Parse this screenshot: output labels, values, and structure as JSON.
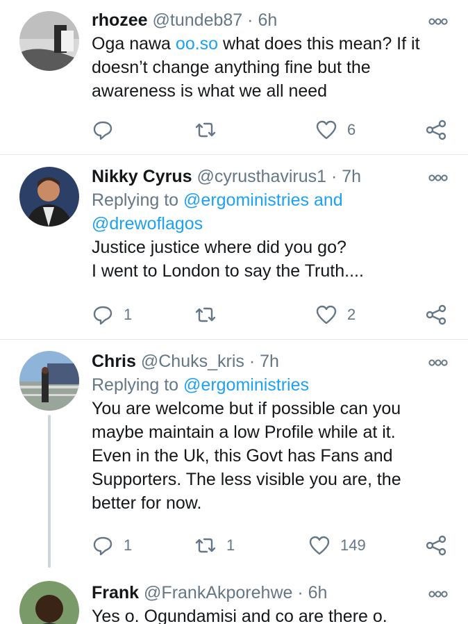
{
  "tweets": [
    {
      "name": "rhozee",
      "handle": "@tundeb87",
      "sep": "·",
      "time": "6h",
      "body_pre": "Oga nawa ",
      "body_link": "oo.so",
      "body_line1_rest": " what does this mean? If it",
      "body_line2": "doesn’t change anything fine but the",
      "body_line3": "awareness is what we all need",
      "replies": "",
      "retweets": "",
      "likes": "6"
    },
    {
      "name": "Nikky Cyrus",
      "handle": "@cyrusthavirus1",
      "sep": "·",
      "time": "7h",
      "replying_prefix": "Replying to ",
      "replying_1": "@ergoministries and",
      "replying_2": "@drewoflagos",
      "body_line1": "Justice justice where did you go?",
      "body_line2": "I went to London to say the Truth....",
      "replies": "1",
      "retweets": "",
      "likes": "2"
    },
    {
      "name": "Chris",
      "handle": "@Chuks_kris",
      "sep": "·",
      "time": "7h",
      "replying_prefix": "Replying to ",
      "replying_1": "@ergoministries",
      "body_line1": "You are welcome but if possible can you",
      "body_line2": "maybe maintain a low Profile while at it.",
      "body_line3": "Even in the Uk, this Govt has Fans and",
      "body_line4": "Supporters. The less visible you are, the",
      "body_line5": "better for now.",
      "replies": "1",
      "retweets": "1",
      "likes": "149"
    },
    {
      "name": "Frank",
      "handle": "@FrankAkporehwe",
      "sep": "·",
      "time": "6h",
      "body_line1": "Yes o. Ogundamisi and co are there o."
    }
  ],
  "icons": {
    "reply": "reply-icon",
    "retweet": "retweet-icon",
    "like": "heart-icon",
    "share": "share-icon",
    "more": "more-icon"
  },
  "colors": {
    "link": "#1da1f2",
    "secondary": "#657786",
    "divider": "#e1e8ed",
    "thread_line": "#ccd6dd"
  }
}
